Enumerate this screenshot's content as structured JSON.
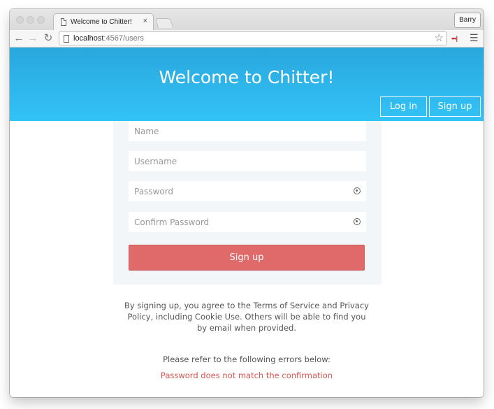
{
  "browser": {
    "tab_title": "Welcome to Chitter!",
    "tab_close": "×",
    "profile_name": "Barry",
    "url_host": "localhost",
    "url_path": ":4567/users",
    "back_icon": "←",
    "forward_icon": "→",
    "reload_icon": "↻",
    "star_icon": "☆",
    "extension_icon": "•••|",
    "menu_icon": "☰"
  },
  "header": {
    "title": "Welcome to Chitter!",
    "login_label": "Log in",
    "signup_label": "Sign up"
  },
  "form": {
    "name_placeholder": "Name",
    "username_placeholder": "Username",
    "password_placeholder": "Password",
    "confirm_placeholder": "Confirm Password",
    "submit_label": "Sign up"
  },
  "terms": "By signing up, you agree to the Terms of Service and Privacy Policy, including Cookie Use. Others will be able to find you by email when provided.",
  "errors": {
    "title": "Please refer to the following errors below:",
    "items": [
      "Password does not match the confirmation"
    ]
  },
  "colors": {
    "header_top": "#29a7dd",
    "header_bottom": "#33c3f7",
    "submit_button": "#e06a69",
    "error_text": "#d9534f",
    "form_panel": "#f2f6f9"
  }
}
